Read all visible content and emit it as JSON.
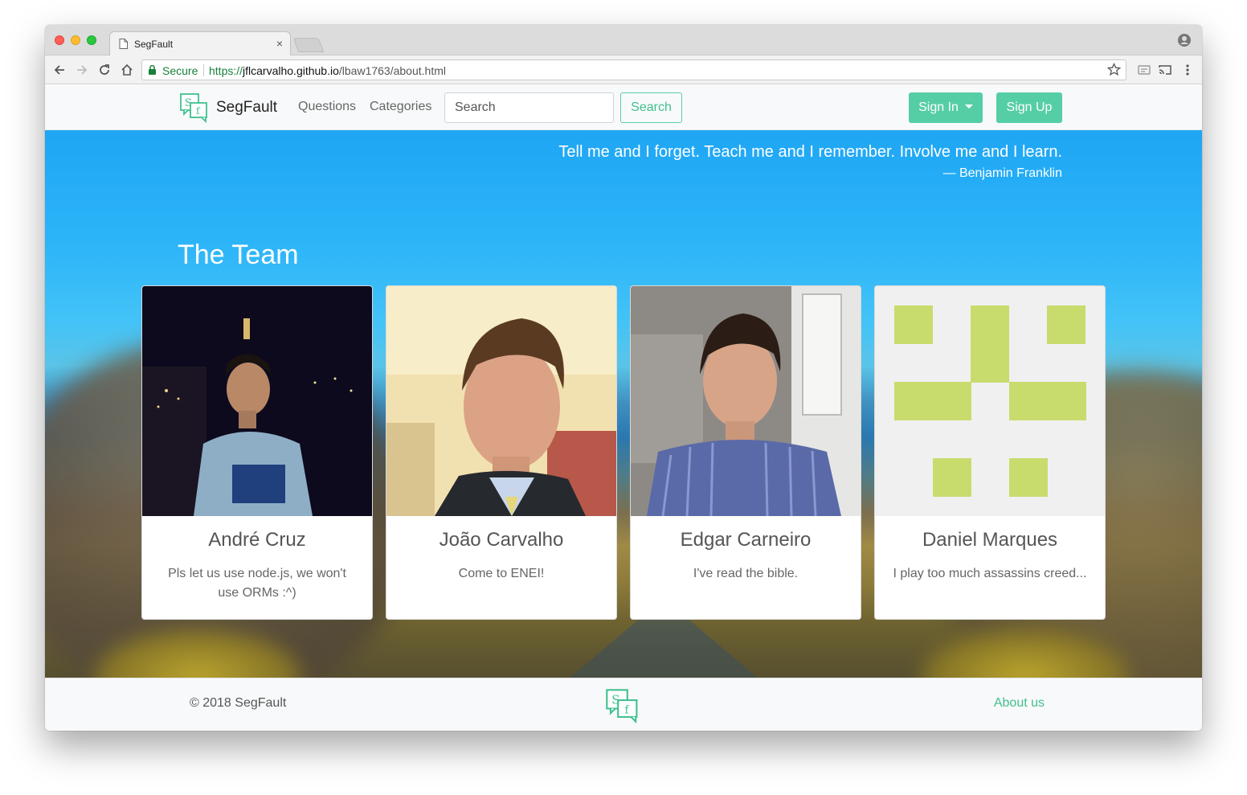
{
  "browser": {
    "tab_title": "SegFault",
    "tab_close": "×",
    "secure_label": "Secure",
    "url_scheme": "https://",
    "url_host": "jflcarvalho.github.io",
    "url_path": "/lbaw1763/about.html"
  },
  "navbar": {
    "brand": "SegFault",
    "links": [
      "Questions",
      "Categories"
    ],
    "search_placeholder": "Search",
    "search_button": "Search",
    "sign_in": "Sign In",
    "sign_up": "Sign Up"
  },
  "hero": {
    "quote": "Tell me and I forget. Teach me and I remember. Involve me and I learn.",
    "author": "— Benjamin Franklin",
    "heading": "The Team"
  },
  "team": [
    {
      "name": "André Cruz",
      "text": "Pls let us use node.js, we won't use ORMs :^)"
    },
    {
      "name": "João Carvalho",
      "text": "Come to ENEI!"
    },
    {
      "name": "Edgar Carneiro",
      "text": "I've read the bible."
    },
    {
      "name": "Daniel Marques",
      "text": "I play too much assassins creed..."
    }
  ],
  "footer": {
    "copyright": "© 2018 SegFault",
    "about": "About us"
  },
  "colors": {
    "accent": "#55cea6",
    "accent_text": "#41c08f",
    "identicon": "#c8dc6e"
  }
}
